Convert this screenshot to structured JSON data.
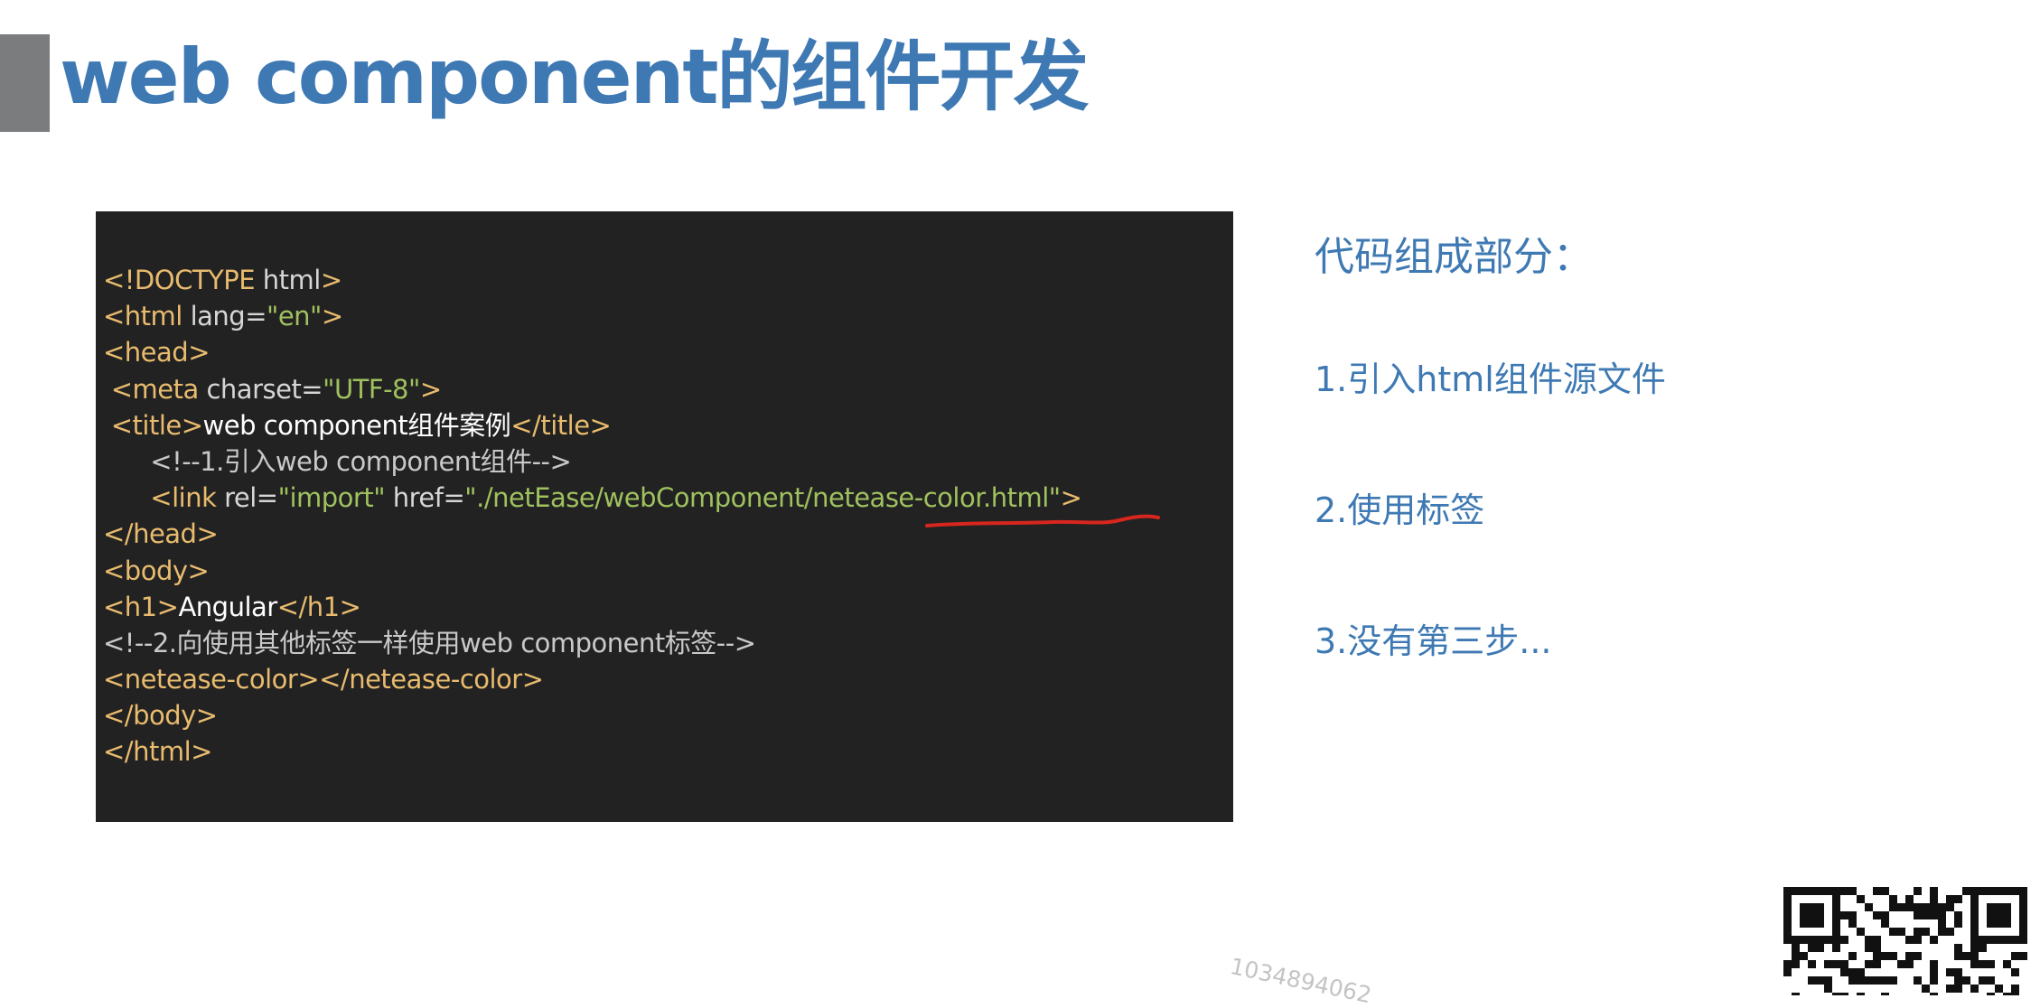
{
  "slide": {
    "title": "web component的组件开发",
    "watermark": "1034894062"
  },
  "code_block": {
    "lines": [
      [
        {
          "t": "tag",
          "v": "<!DOCTYPE "
        },
        {
          "t": "attr",
          "v": "html"
        },
        {
          "t": "tag",
          "v": ">"
        }
      ],
      [
        {
          "t": "tag",
          "v": "<html "
        },
        {
          "t": "attr",
          "v": "lang="
        },
        {
          "t": "str",
          "v": "\"en\""
        },
        {
          "t": "tag",
          "v": ">"
        }
      ],
      [
        {
          "t": "tag",
          "v": "<head>"
        }
      ],
      [
        {
          "t": "tag",
          "v": " <meta "
        },
        {
          "t": "attr",
          "v": "charset="
        },
        {
          "t": "str",
          "v": "\"UTF-8\""
        },
        {
          "t": "tag",
          "v": ">"
        }
      ],
      [
        {
          "t": "tag",
          "v": " <title>"
        },
        {
          "t": "text",
          "v": "web component组件案例"
        },
        {
          "t": "tag",
          "v": "</title>"
        }
      ],
      [
        {
          "t": "com",
          "v": "      <!--1.引入web component组件-->"
        }
      ],
      [
        {
          "t": "tag",
          "v": "      <link "
        },
        {
          "t": "attr",
          "v": "rel="
        },
        {
          "t": "str",
          "v": "\"import\""
        },
        {
          "t": "attr",
          "v": " href="
        },
        {
          "t": "str",
          "v": "\"./netEase/webComponent/netease-color.html\""
        },
        {
          "t": "tag",
          "v": ">"
        }
      ],
      [
        {
          "t": "tag",
          "v": "</head>"
        }
      ],
      [
        {
          "t": "tag",
          "v": "<body>"
        }
      ],
      [
        {
          "t": "tag",
          "v": "<h1>"
        },
        {
          "t": "text",
          "v": "Angular"
        },
        {
          "t": "tag",
          "v": "</h1>"
        }
      ],
      [
        {
          "t": "com",
          "v": "<!--2.向使用其他标签一样使用web component标签-->"
        }
      ],
      [
        {
          "t": "tag",
          "v": "<netease-color></netease-color>"
        }
      ],
      [
        {
          "t": "tag",
          "v": "</body>"
        }
      ],
      [
        {
          "t": "tag",
          "v": "</html>"
        }
      ]
    ]
  },
  "side_notes": {
    "heading": "代码组成部分：",
    "steps": [
      "1.引入html组件源文件",
      "2.使用标签",
      "3.没有第三步..."
    ]
  },
  "colors": {
    "title": "#3e79b3",
    "code_bg": "#222222",
    "code_tag": "#e8bb6e",
    "code_string": "#9fc15e",
    "underline": "#d7261e"
  },
  "icons": {
    "qr_code": "qr-code-icon"
  }
}
